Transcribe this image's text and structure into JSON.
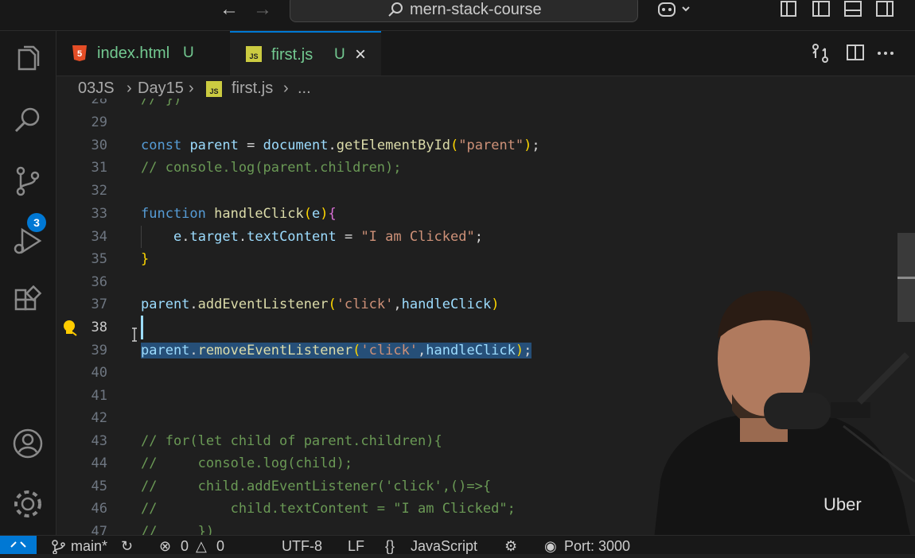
{
  "titlebar": {
    "back_icon": "arrow-left-icon",
    "forward_icon": "arrow-right-icon",
    "search_text": "mern-stack-course"
  },
  "activity_bar": {
    "items": [
      "explorer-icon",
      "search-icon",
      "source-control-icon",
      "run-debug-icon",
      "extensions-icon",
      "account-icon",
      "settings-gear-icon"
    ],
    "source_control_badge": "3"
  },
  "tabs": [
    {
      "label": "index.html",
      "status": "U",
      "icon": "html5-icon"
    },
    {
      "label": "first.js",
      "status": "U",
      "icon": "js-file-icon",
      "active": true
    }
  ],
  "breadcrumb": {
    "parts": [
      "03JS",
      "Day15",
      "first.js",
      "..."
    ]
  },
  "editor": {
    "lines": [
      {
        "n": "28",
        "text": "// })"
      },
      {
        "n": "29",
        "text": ""
      },
      {
        "n": "30",
        "text": "const parent = document.getElementById(\"parent\");"
      },
      {
        "n": "31",
        "text": "// console.log(parent.children);"
      },
      {
        "n": "32",
        "text": ""
      },
      {
        "n": "33",
        "text": "function handleClick(e){"
      },
      {
        "n": "34",
        "text": "    e.target.textContent = \"I am Clicked\";"
      },
      {
        "n": "35",
        "text": "}"
      },
      {
        "n": "36",
        "text": ""
      },
      {
        "n": "37",
        "text": "parent.addEventListener('click',handleClick)"
      },
      {
        "n": "38",
        "text": ""
      },
      {
        "n": "39",
        "text": "parent.removeEventListener('click',handleClick);"
      },
      {
        "n": "40",
        "text": ""
      },
      {
        "n": "41",
        "text": ""
      },
      {
        "n": "42",
        "text": ""
      },
      {
        "n": "43",
        "text": "// for(let child of parent.children){"
      },
      {
        "n": "44",
        "text": "//     console.log(child);"
      },
      {
        "n": "45",
        "text": "//     child.addEventListener('click',()=>{"
      },
      {
        "n": "46",
        "text": "//         child.textContent = \"I am Clicked\";"
      },
      {
        "n": "47",
        "text": "//     })"
      }
    ],
    "active_line": "38",
    "selected_line": "39"
  },
  "statusbar": {
    "branch": "main*",
    "errors": "0",
    "warnings": "0",
    "encoding": "UTF-8",
    "eol": "LF",
    "language": "JavaScript",
    "port": "Port: 3000"
  },
  "webcam_overlay": {
    "shirt_logo": "Uber"
  },
  "colors": {
    "accent": "#0078d4",
    "untracked": "#73c991",
    "selection": "#264f78"
  }
}
